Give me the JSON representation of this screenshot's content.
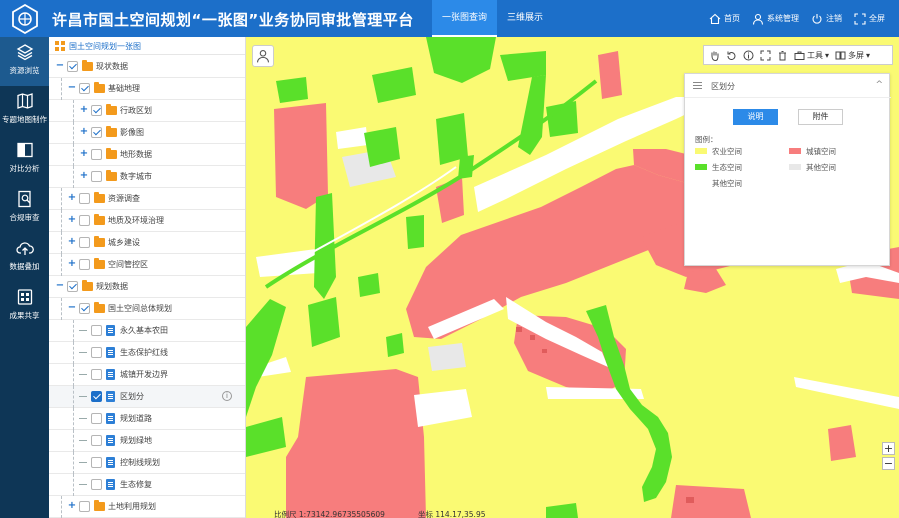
{
  "header": {
    "title": "许昌市国土空间规划“一张图”业务协同审批管理平台",
    "tabs": [
      {
        "label": "一张图查询",
        "active": true
      },
      {
        "label": "三维展示",
        "active": false
      }
    ],
    "actions": [
      {
        "label": "首页",
        "icon": "home-icon"
      },
      {
        "label": "系统管理",
        "icon": "user-icon"
      },
      {
        "label": "注销",
        "icon": "power-icon"
      },
      {
        "label": "全屏",
        "icon": "fullscreen-icon"
      }
    ],
    "color": "#1c6fc9"
  },
  "sidebar": {
    "items": [
      {
        "label": "资源浏览",
        "icon": "layers-icon",
        "active": true
      },
      {
        "label": "专题地图制作",
        "icon": "map-icon",
        "active": false
      },
      {
        "label": "对比分析",
        "icon": "split-icon",
        "active": false
      },
      {
        "label": "合规审查",
        "icon": "audit-icon",
        "active": false
      },
      {
        "label": "数据叠加",
        "icon": "cloud-upload-icon",
        "active": false
      },
      {
        "label": "成果共享",
        "icon": "share-icon",
        "active": false
      }
    ]
  },
  "tree": {
    "title": "国土空间规划一张图",
    "rows": [
      {
        "label": "现状数据",
        "type": "folder",
        "level": 0,
        "expander": "−",
        "check": "partial"
      },
      {
        "label": "基础地理",
        "type": "folder",
        "level": 1,
        "expander": "−",
        "check": "partial"
      },
      {
        "label": "行政区划",
        "type": "folder",
        "level": 2,
        "expander": "+",
        "check": "partial"
      },
      {
        "label": "影像图",
        "type": "folder",
        "level": 2,
        "expander": "+",
        "check": "partial"
      },
      {
        "label": "地形数据",
        "type": "folder",
        "level": 2,
        "expander": "+",
        "check": "none"
      },
      {
        "label": "数字城市",
        "type": "folder",
        "level": 2,
        "expander": "+",
        "check": "none"
      },
      {
        "label": "资源调查",
        "type": "folder",
        "level": 1,
        "expander": "+",
        "check": "none"
      },
      {
        "label": "地质及环境治理",
        "type": "folder",
        "level": 1,
        "expander": "+",
        "check": "none"
      },
      {
        "label": "城乡建设",
        "type": "folder",
        "level": 1,
        "expander": "+",
        "check": "none"
      },
      {
        "label": "空间管控区",
        "type": "folder",
        "level": 1,
        "expander": "+",
        "check": "none"
      },
      {
        "label": "规划数据",
        "type": "folder",
        "level": 0,
        "expander": "−",
        "check": "partial"
      },
      {
        "label": "国土空间总体规划",
        "type": "folder",
        "level": 1,
        "expander": "−",
        "check": "partial"
      },
      {
        "label": "永久基本农田",
        "type": "file",
        "level": 2,
        "check": "none"
      },
      {
        "label": "生态保护红线",
        "type": "file",
        "level": 2,
        "check": "none"
      },
      {
        "label": "城镇开发边界",
        "type": "file",
        "level": 2,
        "check": "none"
      },
      {
        "label": "区划分",
        "type": "file",
        "level": 2,
        "check": "full",
        "selected": true,
        "info": true
      },
      {
        "label": "规划道路",
        "type": "file",
        "level": 2,
        "check": "none"
      },
      {
        "label": "规划绿地",
        "type": "file",
        "level": 2,
        "check": "none"
      },
      {
        "label": "控制线规划",
        "type": "file",
        "level": 2,
        "check": "none"
      },
      {
        "label": "生态修复",
        "type": "file",
        "level": 2,
        "check": "none"
      },
      {
        "label": "土地利用规划",
        "type": "folder",
        "level": 1,
        "expander": "+",
        "check": "none"
      }
    ]
  },
  "map": {
    "toolbar": {
      "tools_label": "工具",
      "more_label": "多屏"
    },
    "scale_text": "比例尺 1:73142.96735505609",
    "coord_text": "坐标 114.17,35.95",
    "zoom_in": "+",
    "zoom_out": "−",
    "colors": {
      "agri": "#fafa73",
      "urban": "#f77d7d",
      "eco": "#5ae02a",
      "road": "#ffffff"
    }
  },
  "layer_panel": {
    "title": "区划分",
    "tab_desc": "说明",
    "tab_attach": "附件",
    "legend_title": "图例：",
    "legend": [
      {
        "label": "农业空间",
        "color": "#fafa73"
      },
      {
        "label": "城镇空间",
        "color": "#f77d7d"
      },
      {
        "label": "生态空间",
        "color": "#5ae02a"
      },
      {
        "label": "其他空间",
        "color": "#e8e8e8"
      },
      {
        "label": "其他空间",
        "color": "#ffffff"
      }
    ],
    "close_symbol": "^"
  }
}
